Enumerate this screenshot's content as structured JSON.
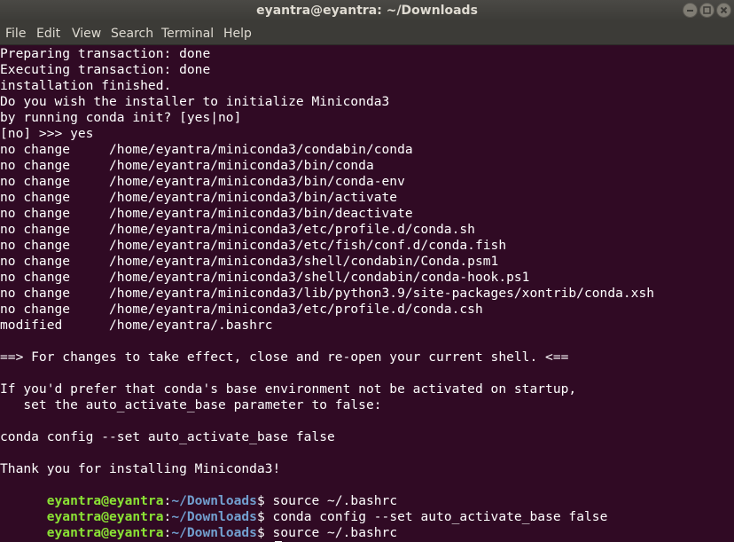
{
  "window": {
    "title": "eyantra@eyantra: ~/Downloads"
  },
  "menu": {
    "items": [
      "File",
      "Edit",
      "View",
      "Search",
      "Terminal",
      "Help"
    ]
  },
  "terminal": {
    "output": [
      "Preparing transaction: done",
      "Executing transaction: done",
      "installation finished.",
      "Do you wish the installer to initialize Miniconda3",
      "by running conda init? [yes|no]",
      "[no] >>> yes",
      "no change     /home/eyantra/miniconda3/condabin/conda",
      "no change     /home/eyantra/miniconda3/bin/conda",
      "no change     /home/eyantra/miniconda3/bin/conda-env",
      "no change     /home/eyantra/miniconda3/bin/activate",
      "no change     /home/eyantra/miniconda3/bin/deactivate",
      "no change     /home/eyantra/miniconda3/etc/profile.d/conda.sh",
      "no change     /home/eyantra/miniconda3/etc/fish/conf.d/conda.fish",
      "no change     /home/eyantra/miniconda3/shell/condabin/Conda.psm1",
      "no change     /home/eyantra/miniconda3/shell/condabin/conda-hook.ps1",
      "no change     /home/eyantra/miniconda3/lib/python3.9/site-packages/xontrib/conda.xsh",
      "no change     /home/eyantra/miniconda3/etc/profile.d/conda.csh",
      "modified      /home/eyantra/.bashrc",
      "",
      "==> For changes to take effect, close and re-open your current shell. <==",
      "",
      "If you'd prefer that conda's base environment not be activated on startup,",
      "   set the auto_activate_base parameter to false:",
      "",
      "conda config --set auto_activate_base false",
      "",
      "Thank you for installing Miniconda3!"
    ],
    "prompt": {
      "user": "eyantra@eyantra",
      "sep": ":",
      "path": "~/Downloads",
      "symbol": "$ "
    },
    "commands": [
      "source ~/.bashrc",
      "conda config --set auto_activate_base false",
      "source ~/.bashrc",
      ""
    ]
  },
  "colors": {
    "background": "#300a24",
    "text": "#ffffff",
    "prompt_user": "#8ae234",
    "prompt_path": "#729fcf"
  },
  "icons": {
    "window_buttons": [
      "minimize-icon",
      "maximize-icon",
      "close-icon"
    ]
  }
}
